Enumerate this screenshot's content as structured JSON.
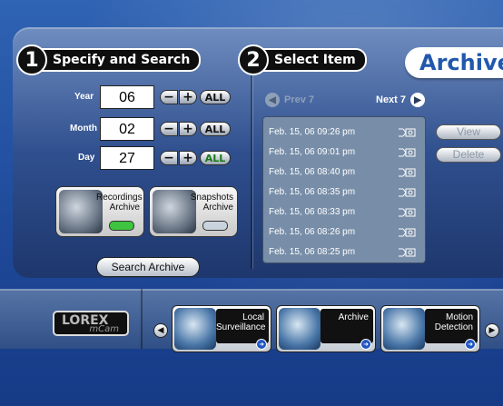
{
  "header": {
    "title": "Archive"
  },
  "steps": [
    {
      "number": "1",
      "label": "Specify and Search"
    },
    {
      "number": "2",
      "label": "Select Item"
    }
  ],
  "search": {
    "rows": [
      {
        "label": "Year",
        "value": "06",
        "all": "ALL",
        "all_active": false
      },
      {
        "label": "Month",
        "value": "02",
        "all": "ALL",
        "all_active": false
      },
      {
        "label": "Day",
        "value": "27",
        "all": "ALL",
        "all_active": true
      }
    ],
    "minus": "−",
    "plus": "+",
    "recordings": {
      "label_line1": "Recordings",
      "label_line2": "Archive",
      "indicator_color": "#3ec43e"
    },
    "snapshots": {
      "label_line1": "Snapshots",
      "label_line2": "Archive",
      "indicator_color": "#c9d3dd"
    },
    "search_button": "Search Archive"
  },
  "items": {
    "prev": "Prev 7",
    "next": "Next 7",
    "list": [
      "Feb. 15, 06 09:26 pm",
      "Feb. 15, 06 09:01 pm",
      "Feb. 15, 06 08:40 pm",
      "Feb. 15, 06 08:35 pm",
      "Feb. 15, 06 08:33 pm",
      "Feb. 15, 06 08:26 pm",
      "Feb. 15, 06 08:25 pm"
    ],
    "view_button": "View",
    "delete_button": "Delete"
  },
  "footer": {
    "logo_line1": "LOREX",
    "logo_line2": "mCam",
    "tiles": [
      {
        "line1": "Local",
        "line2": "Surveillance"
      },
      {
        "line1": "Archive",
        "line2": ""
      },
      {
        "line1": "Motion",
        "line2": "Detection"
      }
    ]
  },
  "colors": {
    "accent": "#2158ad",
    "panel": "#2f4f8e",
    "active_green": "#1a7a1a"
  }
}
